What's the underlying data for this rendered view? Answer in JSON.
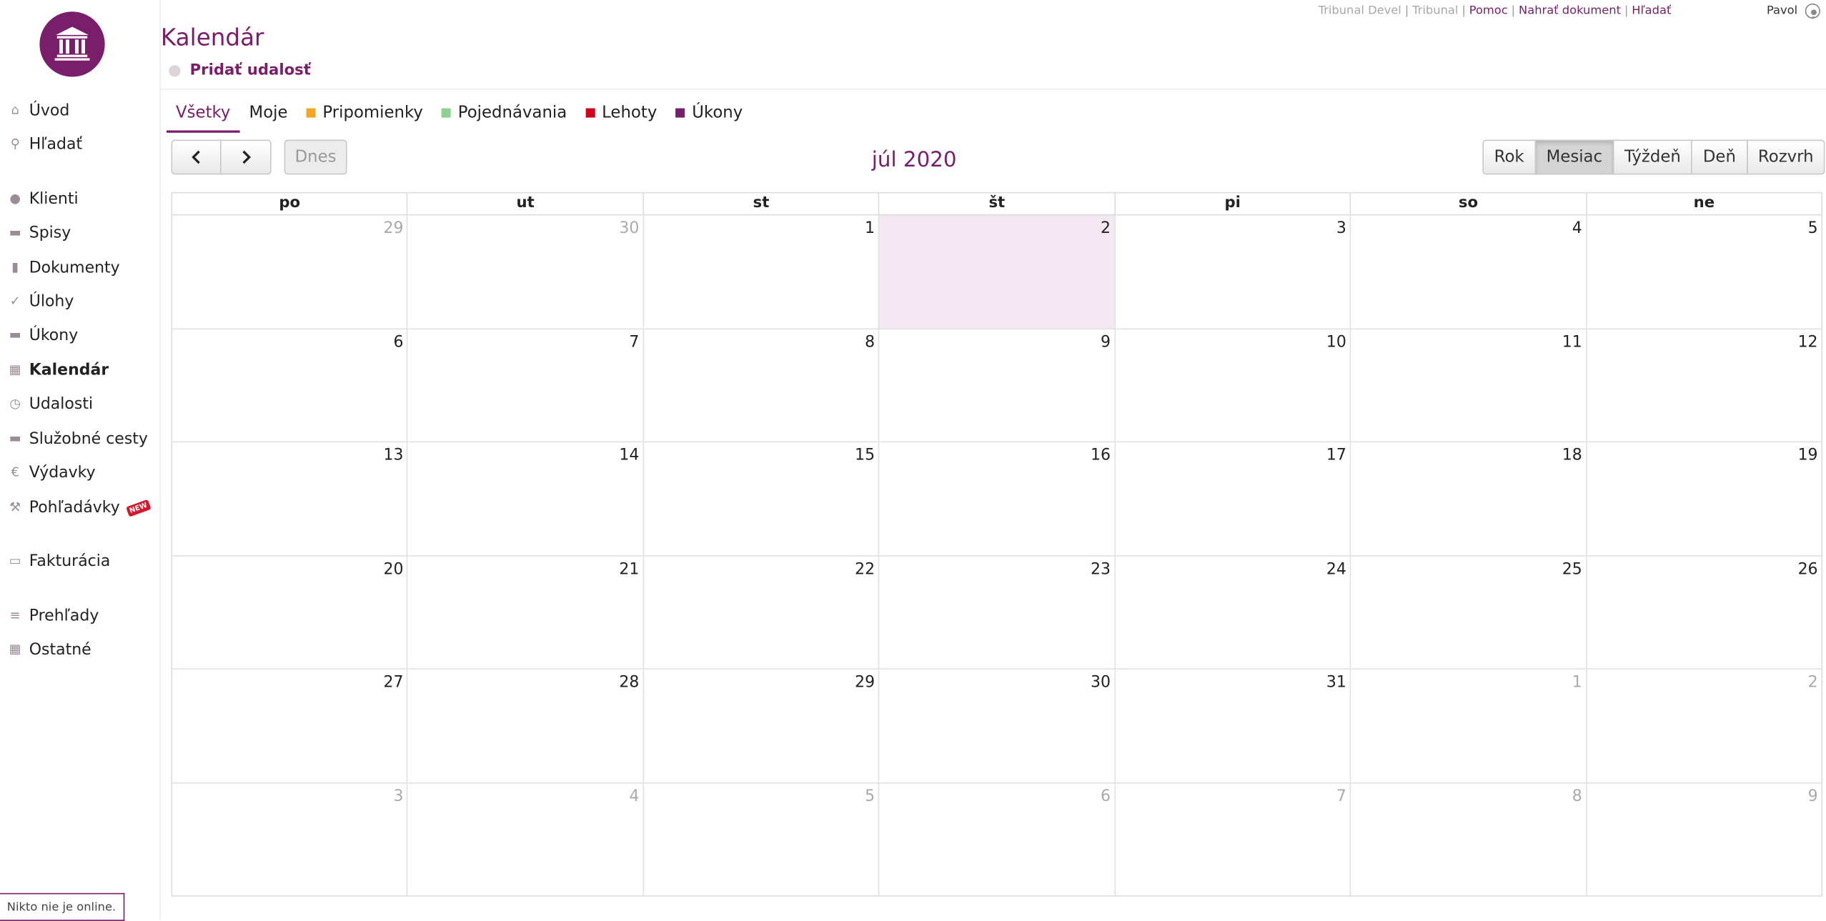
{
  "header": {
    "links": [
      {
        "label": "Tribunal Devel",
        "kind": "dim"
      },
      {
        "label": "Tribunal",
        "kind": "dim"
      },
      {
        "label": "Pomoc",
        "kind": "link"
      },
      {
        "label": "Nahrať dokument",
        "kind": "link"
      },
      {
        "label": "Hľadať",
        "kind": "link"
      }
    ],
    "separator": "|",
    "user_name": "Pavol",
    "page_title": "Kalendár",
    "add_event_label": "Pridať udalosť"
  },
  "sidebar": {
    "items": [
      {
        "label": "Úvod",
        "icon": "home-icon",
        "glyph": "⌂"
      },
      {
        "label": "Hľadať",
        "icon": "search-icon",
        "glyph": "⚲"
      },
      {
        "label": "Klienti",
        "icon": "user-icon",
        "glyph": "●"
      },
      {
        "label": "Spisy",
        "icon": "folder-icon",
        "glyph": "▬"
      },
      {
        "label": "Dokumenty",
        "icon": "document-icon",
        "glyph": "▮"
      },
      {
        "label": "Úlohy",
        "icon": "check-icon",
        "glyph": "✓"
      },
      {
        "label": "Úkony",
        "icon": "briefcase-icon",
        "glyph": "▬"
      },
      {
        "label": "Kalendár",
        "icon": "calendar-icon",
        "glyph": "▦",
        "active": true
      },
      {
        "label": "Udalosti",
        "icon": "clock-icon",
        "glyph": "◷"
      },
      {
        "label": "Služobné cesty",
        "icon": "car-icon",
        "glyph": "▬"
      },
      {
        "label": "Výdavky",
        "icon": "euro-icon",
        "glyph": "€"
      },
      {
        "label": "Pohľadávky",
        "icon": "gavel-icon",
        "glyph": "⚒",
        "badge": "NEW"
      },
      {
        "label": "Fakturácia",
        "icon": "money-icon",
        "glyph": "▭"
      },
      {
        "label": "Prehľady",
        "icon": "list-icon",
        "glyph": "≡"
      },
      {
        "label": "Ostatné",
        "icon": "calculator-icon",
        "glyph": "▦"
      }
    ],
    "online_status": "Nikto nie je online."
  },
  "filters": [
    {
      "label": "Všetky",
      "active": true
    },
    {
      "label": "Moje"
    },
    {
      "label": "Pripomienky",
      "color": "#f5a623"
    },
    {
      "label": "Pojednávania",
      "color": "#8fd18f"
    },
    {
      "label": "Lehoty",
      "color": "#d0021b"
    },
    {
      "label": "Úkony",
      "color": "#7a1d6a"
    }
  ],
  "toolbar": {
    "prev_icon": "‹",
    "next_icon": "›",
    "today_label": "Dnes",
    "month_title": "júl 2020",
    "views": [
      {
        "label": "Rok"
      },
      {
        "label": "Mesiac",
        "active": true
      },
      {
        "label": "Týždeň"
      },
      {
        "label": "Deň"
      },
      {
        "label": "Rozvrh"
      }
    ]
  },
  "calendar": {
    "weekdays": [
      "po",
      "ut",
      "st",
      "št",
      "pi",
      "so",
      "ne"
    ],
    "today": "2",
    "weeks": [
      [
        {
          "d": "29",
          "o": true
        },
        {
          "d": "30",
          "o": true
        },
        {
          "d": "1"
        },
        {
          "d": "2",
          "t": true
        },
        {
          "d": "3"
        },
        {
          "d": "4"
        },
        {
          "d": "5"
        }
      ],
      [
        {
          "d": "6"
        },
        {
          "d": "7"
        },
        {
          "d": "8"
        },
        {
          "d": "9"
        },
        {
          "d": "10"
        },
        {
          "d": "11"
        },
        {
          "d": "12"
        }
      ],
      [
        {
          "d": "13"
        },
        {
          "d": "14"
        },
        {
          "d": "15"
        },
        {
          "d": "16"
        },
        {
          "d": "17"
        },
        {
          "d": "18"
        },
        {
          "d": "19"
        }
      ],
      [
        {
          "d": "20"
        },
        {
          "d": "21"
        },
        {
          "d": "22"
        },
        {
          "d": "23"
        },
        {
          "d": "24"
        },
        {
          "d": "25"
        },
        {
          "d": "26"
        }
      ],
      [
        {
          "d": "27"
        },
        {
          "d": "28"
        },
        {
          "d": "29"
        },
        {
          "d": "30"
        },
        {
          "d": "31"
        },
        {
          "d": "1",
          "o": true
        },
        {
          "d": "2",
          "o": true
        }
      ],
      [
        {
          "d": "3",
          "o": true
        },
        {
          "d": "4",
          "o": true
        },
        {
          "d": "5",
          "o": true
        },
        {
          "d": "6",
          "o": true
        },
        {
          "d": "7",
          "o": true
        },
        {
          "d": "8",
          "o": true
        },
        {
          "d": "9",
          "o": true
        }
      ]
    ]
  }
}
